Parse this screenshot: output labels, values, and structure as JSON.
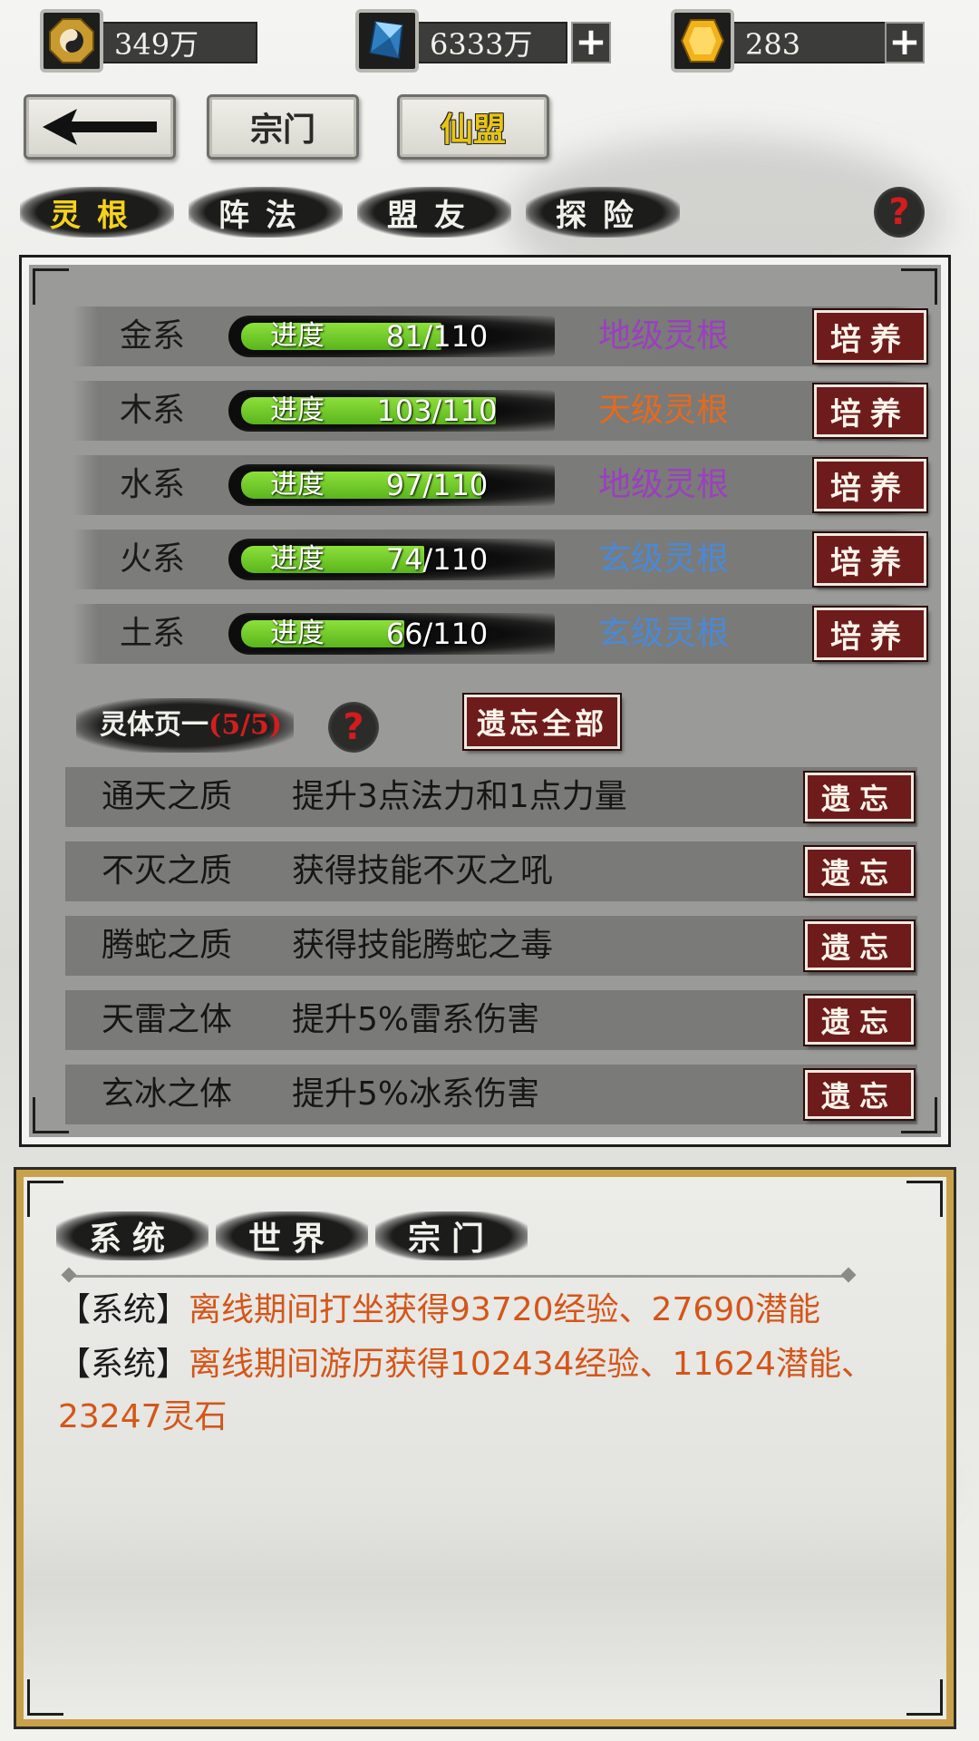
{
  "resources": [
    {
      "icon": "taiji-coin-icon",
      "value": "349万",
      "plus": false
    },
    {
      "icon": "blue-crystal-icon",
      "value": "6333万",
      "plus": true
    },
    {
      "icon": "gold-gem-icon",
      "value": "283",
      "plus": true
    }
  ],
  "nav": {
    "back": "back-arrow",
    "sect": "宗门",
    "alliance": "仙盟"
  },
  "tabs": [
    "灵根",
    "阵法",
    "盟友",
    "探险"
  ],
  "spirit_roots": [
    {
      "name": "金系",
      "progress_label": "进度",
      "progress": "81/110",
      "current": 81,
      "max": 110,
      "grade": "地级灵根",
      "grade_color": "#9b3fbf",
      "button": "培养"
    },
    {
      "name": "木系",
      "progress_label": "进度",
      "progress": "103/110",
      "current": 103,
      "max": 110,
      "grade": "天级灵根",
      "grade_color": "#e36a1f",
      "button": "培养"
    },
    {
      "name": "水系",
      "progress_label": "进度",
      "progress": "97/110",
      "current": 97,
      "max": 110,
      "grade": "地级灵根",
      "grade_color": "#9b3fbf",
      "button": "培养"
    },
    {
      "name": "火系",
      "progress_label": "进度",
      "progress": "74/110",
      "current": 74,
      "max": 110,
      "grade": "玄级灵根",
      "grade_color": "#4a89d6",
      "button": "培养"
    },
    {
      "name": "土系",
      "progress_label": "进度",
      "progress": "66/110",
      "current": 66,
      "max": 110,
      "grade": "玄级灵根",
      "grade_color": "#4a89d6",
      "button": "培养"
    }
  ],
  "spirit_body": {
    "title": "灵体页一",
    "count": "(5/5)",
    "forget_all": "遗忘全部"
  },
  "traits": [
    {
      "name": "通天之质",
      "desc": "提升3点法力和1点力量",
      "button": "遗忘"
    },
    {
      "name": "不灭之质",
      "desc": "获得技能不灭之吼",
      "button": "遗忘"
    },
    {
      "name": "腾蛇之质",
      "desc": "获得技能腾蛇之毒",
      "button": "遗忘"
    },
    {
      "name": "天雷之体",
      "desc": "提升5%雷系伤害",
      "button": "遗忘"
    },
    {
      "name": "玄冰之体",
      "desc": "提升5%冰系伤害",
      "button": "遗忘"
    }
  ],
  "chat": {
    "tabs": [
      "系统",
      "世界",
      "宗门"
    ],
    "messages": [
      {
        "tag": "【系统】",
        "text": "离线期间打坐获得93720经验、27690潜能"
      },
      {
        "tag": "【系统】",
        "text": "离线期间游历获得102434经验、11624潜能、23247灵石"
      }
    ]
  },
  "colors": {
    "tab_active": "#f5d21c",
    "button_red": "#6e1b1b",
    "chat_text": "#d4561a",
    "progress_green": "#6fcd27"
  }
}
